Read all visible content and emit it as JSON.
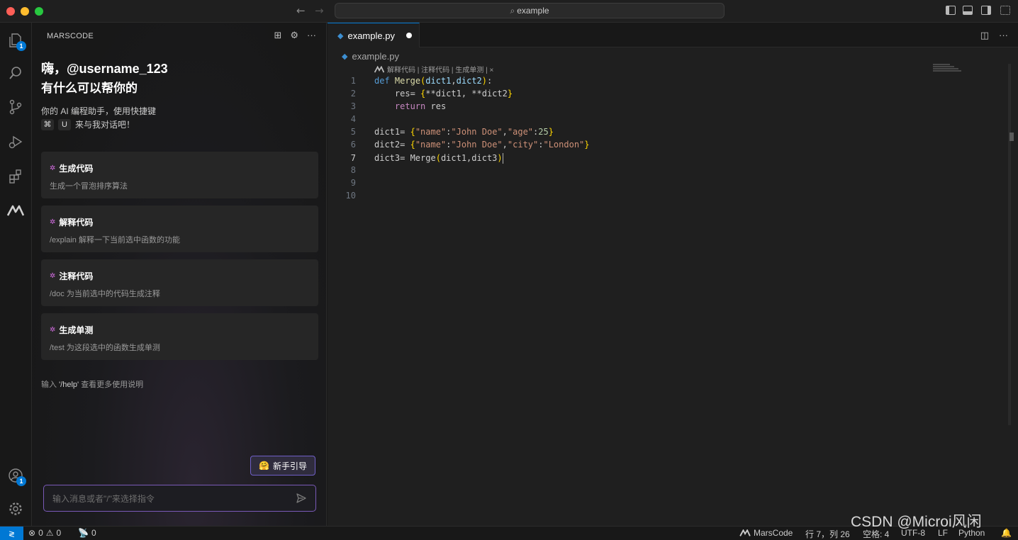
{
  "window": {
    "search_text": "example",
    "back_arrow": "←",
    "forward_arrow": "→"
  },
  "activity": {
    "explorer_badge": "1",
    "accounts_badge": "1"
  },
  "sidebar": {
    "title": "MARSCODE",
    "greeting_line1": "嗨，@username_123",
    "greeting_line2": "有什么可以帮你的",
    "desc_line1": "你的 AI 编程助手，使用快捷键",
    "shortcut_key1": "⌘",
    "shortcut_key2": "U",
    "desc_line2": "来与我对话吧！",
    "cards": [
      {
        "title": "生成代码",
        "subtitle": "生成一个冒泡排序算法"
      },
      {
        "title": "解释代码",
        "subtitle": "/explain 解释一下当前选中函数的功能"
      },
      {
        "title": "注释代码",
        "subtitle": "/doc 为当前选中的代码生成注释"
      },
      {
        "title": "生成单测",
        "subtitle": "/test 为这段选中的函数生成单测"
      }
    ],
    "help_prefix": "输入",
    "help_cmd": "'/help'",
    "help_suffix": "查看更多使用说明",
    "guide_button": "新手引导",
    "chat_placeholder": "输入消息或者\"/\"来选择指令"
  },
  "editor": {
    "tab_name": "example.py",
    "breadcrumb_file": "example.py",
    "codelens": "解释代码 | 注释代码 | 生成单测 | ×",
    "line_numbers": [
      "1",
      "2",
      "3",
      "4",
      "5",
      "6",
      "7",
      "8",
      "9",
      "10"
    ],
    "current_line": 7
  },
  "status": {
    "errors": "0",
    "warnings": "0",
    "ports": "0",
    "marscode": "MarsCode",
    "position": "行 7，列 26",
    "spaces": "空格: 4",
    "encoding": "UTF-8",
    "eol": "LF",
    "language": "Python"
  },
  "watermark": "CSDN @Microi风闲",
  "colors": {
    "accent": "#0078d4",
    "keyword": "#569cd6",
    "control_keyword": "#c586c0",
    "function": "#dcdcaa",
    "string": "#ce9178",
    "number": "#b5cea8",
    "guide_border": "#6f5fc7"
  }
}
